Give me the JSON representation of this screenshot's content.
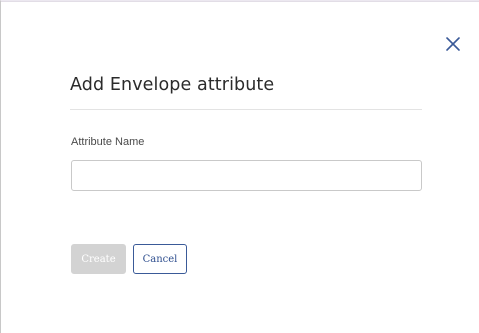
{
  "dialog": {
    "title": "Add Envelope attribute",
    "close_icon": "close-icon",
    "field": {
      "label": "Attribute Name",
      "value": "",
      "placeholder": ""
    },
    "buttons": {
      "create_label": "Create",
      "cancel_label": "Cancel",
      "create_enabled": false
    }
  },
  "colors": {
    "accent": "#3a5a98",
    "disabled_button": "#d3d3d3",
    "title_text": "#2b2b2b",
    "border": "#c9c9c9"
  }
}
